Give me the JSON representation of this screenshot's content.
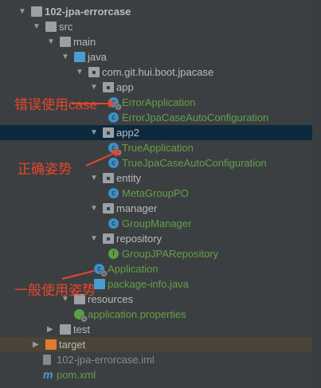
{
  "tree": [
    {
      "label": "102-jpa-errorcase",
      "level": 0,
      "icon": "module-folder-icon",
      "expanded": true,
      "bold": true
    },
    {
      "label": "src",
      "level": 1,
      "icon": "folder-icon",
      "expanded": true
    },
    {
      "label": "main",
      "level": 2,
      "icon": "folder-icon",
      "expanded": true
    },
    {
      "label": "java",
      "level": 3,
      "icon": "source-folder-icon",
      "expanded": true
    },
    {
      "label": "com.git.hui.boot.jpacase",
      "level": 4,
      "icon": "package-icon",
      "expanded": true
    },
    {
      "label": "app",
      "level": 5,
      "icon": "package-icon",
      "expanded": true
    },
    {
      "label": "ErrorApplication",
      "level": 6,
      "icon": "spring-boot-class-icon"
    },
    {
      "label": "ErrorJpaCaseAutoConfiguration",
      "level": 6,
      "icon": "class-icon"
    },
    {
      "label": "app2",
      "level": 5,
      "icon": "package-icon",
      "expanded": true,
      "selected": true
    },
    {
      "label": "TrueApplication",
      "level": 6,
      "icon": "spring-boot-class-icon"
    },
    {
      "label": "TrueJpaCaseAutoConfiguration",
      "level": 6,
      "icon": "class-icon"
    },
    {
      "label": "entity",
      "level": 5,
      "icon": "package-icon",
      "expanded": true
    },
    {
      "label": "MetaGroupPO",
      "level": 6,
      "icon": "class-icon"
    },
    {
      "label": "manager",
      "level": 5,
      "icon": "package-icon",
      "expanded": true
    },
    {
      "label": "GroupManager",
      "level": 6,
      "icon": "class-icon"
    },
    {
      "label": "repository",
      "level": 5,
      "icon": "package-icon",
      "expanded": true
    },
    {
      "label": "GroupJPARepository",
      "level": 6,
      "icon": "interface-icon"
    },
    {
      "label": "Application",
      "level": 5,
      "icon": "spring-boot-class-icon"
    },
    {
      "label": "package-info.java",
      "level": 5,
      "icon": "java-file-icon"
    },
    {
      "label": "resources",
      "level": 3,
      "icon": "resources-folder-icon",
      "expanded": true
    },
    {
      "label": "application.properties",
      "level": 4,
      "icon": "spring-properties-icon"
    },
    {
      "label": "test",
      "level": 2,
      "icon": "folder-icon",
      "expanded": false
    },
    {
      "label": "target",
      "level": 1,
      "icon": "excluded-folder-icon",
      "expanded": false,
      "excluded": true
    },
    {
      "label": "102-jpa-errorcase.iml",
      "level": 1,
      "icon": "iml-file-icon",
      "gray": true
    },
    {
      "label": "pom.xml",
      "level": 1,
      "icon": "maven-icon"
    }
  ],
  "annotations": {
    "error_case": "错误使用case",
    "correct": "正确姿势",
    "general": "一般使用姿势"
  },
  "colors": {
    "annotation": "#e8452c",
    "selected_row": "#0d293e",
    "file_green": "#62a049"
  }
}
